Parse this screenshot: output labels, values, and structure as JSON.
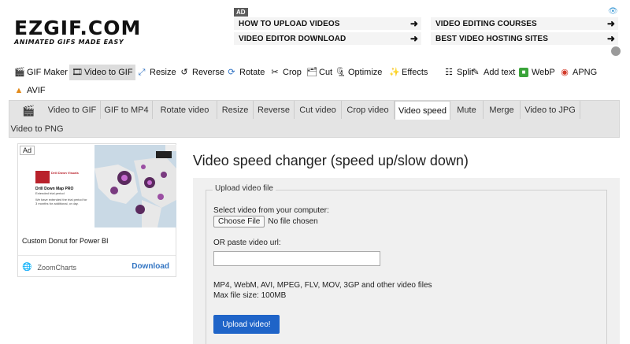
{
  "logo": {
    "name": "EZGIF.COM",
    "tagline": "ANIMATED GIFS MADE EASY"
  },
  "top_ad": {
    "badge": "AD",
    "links": [
      "HOW TO UPLOAD VIDEOS",
      "VIDEO EDITOR DOWNLOAD",
      "VIDEO EDITING COURSES",
      "BEST VIDEO HOSTING SITES"
    ],
    "arrow": "➜",
    "info_icon": "eye-icon"
  },
  "tool_nav": [
    {
      "label": "GIF Maker",
      "icon": "gif-maker-icon"
    },
    {
      "label": "Video to GIF",
      "icon": "video-to-gif-icon",
      "active": true
    },
    {
      "label": "Resize",
      "icon": "resize-icon"
    },
    {
      "label": "Reverse",
      "icon": "reverse-icon"
    },
    {
      "label": "Rotate",
      "icon": "rotate-icon"
    },
    {
      "label": "Crop",
      "icon": "crop-icon"
    },
    {
      "label": "Cut",
      "icon": "cut-icon"
    },
    {
      "label": "Optimize",
      "icon": "optimize-icon"
    },
    {
      "label": "Effects",
      "icon": "effects-icon"
    },
    {
      "label": "Split",
      "icon": "split-icon"
    },
    {
      "label": "Add text",
      "icon": "add-text-icon"
    },
    {
      "label": "WebP",
      "icon": "webp-icon"
    },
    {
      "label": "APNG",
      "icon": "apng-icon"
    },
    {
      "label": "AVIF",
      "icon": "avif-icon"
    }
  ],
  "sub_nav": {
    "icon": "film-icon",
    "items": [
      "Video to GIF",
      "GIF to MP4",
      "Rotate video",
      "Resize",
      "Reverse",
      "Cut video",
      "Crop video",
      "Video speed",
      "Mute",
      "Merge",
      "Video to JPG",
      "Video to PNG"
    ],
    "active": "Video speed"
  },
  "side_ad": {
    "tag": "Ad",
    "card_heading": "Drill Down Visuals",
    "card_title": "Drill Down Map PRO",
    "card_sub": "Extended trial period",
    "card_text": "We have extended the trial period for 3 months for additional, or day.",
    "title": "Custom Donut for Power BI",
    "brand": "ZoomCharts",
    "cta": "Download"
  },
  "main": {
    "title": "Video speed changer (speed up/slow down)",
    "legend": "Upload video file",
    "select_label": "Select video from your computer:",
    "choose_button": "Choose File",
    "no_file": "No file chosen",
    "url_label": "OR paste video url:",
    "url_value": "",
    "formats": "MP4, WebM, AVI, MPEG, FLV, MOV, 3GP and other video files",
    "max_size": "Max file size: 100MB",
    "upload_button": "Upload video!"
  },
  "colors": {
    "accent": "#1f64c8",
    "link": "#3476c3",
    "nav_bg": "#e4e4e4"
  }
}
